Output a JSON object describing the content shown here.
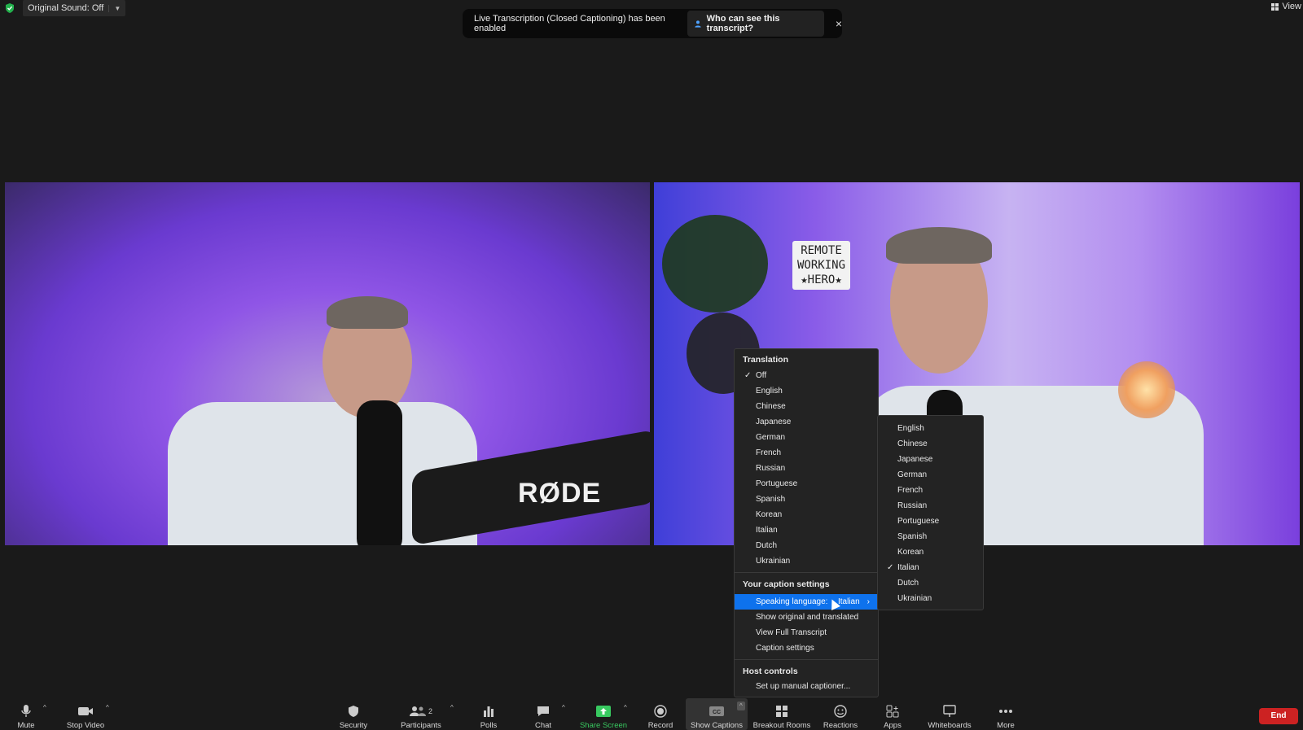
{
  "topbar": {
    "original_sound": "Original Sound: Off",
    "view": "View"
  },
  "notification": {
    "message": "Live Transcription (Closed Captioning) has been enabled",
    "who_button": "Who can see this transcript?",
    "close": "×"
  },
  "video": {
    "left_brand": "RØDE",
    "right_sign": [
      "REMOTE",
      "WORKING",
      "★HERO★"
    ]
  },
  "menu": {
    "translation_header": "Translation",
    "translation_items": [
      {
        "label": "Off",
        "checked": true
      },
      {
        "label": "English",
        "checked": false
      },
      {
        "label": "Chinese",
        "checked": false
      },
      {
        "label": "Japanese",
        "checked": false
      },
      {
        "label": "German",
        "checked": false
      },
      {
        "label": "French",
        "checked": false
      },
      {
        "label": "Russian",
        "checked": false
      },
      {
        "label": "Portuguese",
        "checked": false
      },
      {
        "label": "Spanish",
        "checked": false
      },
      {
        "label": "Korean",
        "checked": false
      },
      {
        "label": "Italian",
        "checked": false
      },
      {
        "label": "Dutch",
        "checked": false
      },
      {
        "label": "Ukrainian",
        "checked": false
      }
    ],
    "caption_header": "Your caption settings",
    "speaking_language_label": "Speaking language:",
    "speaking_language_value": "Italian",
    "show_original": "Show original and translated",
    "view_transcript": "View Full Transcript",
    "caption_settings": "Caption settings",
    "host_header": "Host controls",
    "manual_captioner": "Set up manual captioner..."
  },
  "submenu": {
    "items": [
      {
        "label": "English",
        "checked": false
      },
      {
        "label": "Chinese",
        "checked": false
      },
      {
        "label": "Japanese",
        "checked": false
      },
      {
        "label": "German",
        "checked": false
      },
      {
        "label": "French",
        "checked": false
      },
      {
        "label": "Russian",
        "checked": false
      },
      {
        "label": "Portuguese",
        "checked": false
      },
      {
        "label": "Spanish",
        "checked": false
      },
      {
        "label": "Korean",
        "checked": false
      },
      {
        "label": "Italian",
        "checked": true
      },
      {
        "label": "Dutch",
        "checked": false
      },
      {
        "label": "Ukrainian",
        "checked": false
      }
    ]
  },
  "toolbar": {
    "mute": "Mute",
    "stop_video": "Stop Video",
    "security": "Security",
    "participants": "Participants",
    "participants_count": "2",
    "polls": "Polls",
    "chat": "Chat",
    "share_screen": "Share Screen",
    "record": "Record",
    "show_captions": "Show Captions",
    "breakout_rooms": "Breakout Rooms",
    "reactions": "Reactions",
    "apps": "Apps",
    "whiteboards": "Whiteboards",
    "more": "More",
    "end": "End"
  },
  "colors": {
    "accent": "#0e72ed",
    "share_green": "#38c960",
    "end_red": "#cc2222"
  }
}
